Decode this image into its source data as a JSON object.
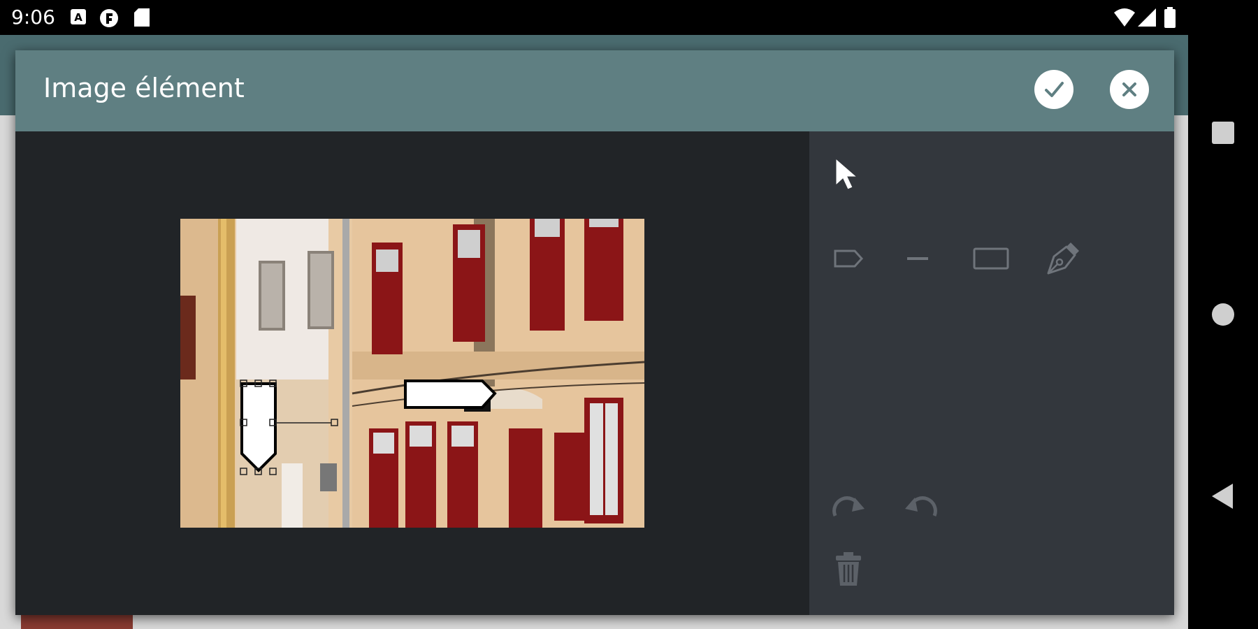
{
  "status_bar": {
    "time": "9:06",
    "left_icons": [
      "a-notification-icon",
      "f-notification-icon",
      "sd-card-icon"
    ],
    "right_icons": [
      "wifi-icon",
      "signal-icon",
      "battery-icon"
    ]
  },
  "dialog": {
    "title": "Image élément",
    "confirm_icon": "check-icon",
    "close_icon": "close-icon"
  },
  "tools": {
    "select": "cursor-icon",
    "shapes": [
      "tag-shape-icon",
      "line-icon",
      "rectangle-icon",
      "pen-icon"
    ],
    "history": [
      "redo-icon",
      "undo-icon"
    ],
    "delete": "trash-icon"
  },
  "nav": [
    "recents-icon",
    "home-icon",
    "back-icon"
  ],
  "colors": {
    "header": "#5f7f82",
    "canvas": "#212427",
    "panel": "#33373d",
    "shutter_red": "#8b1517",
    "wall": "#e6c8a3"
  }
}
